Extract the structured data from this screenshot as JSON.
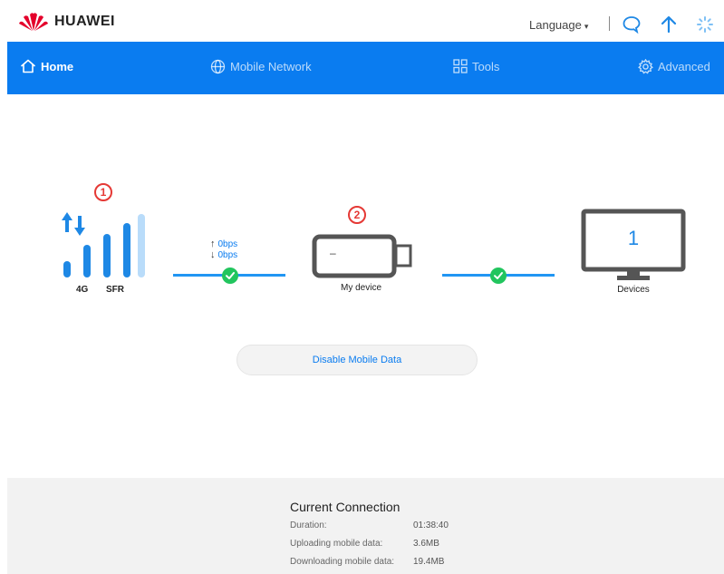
{
  "header": {
    "brand": "HUAWEI",
    "language_label": "Language",
    "brand_color": "#e4002b",
    "icons": [
      "message-icon",
      "upload-arrow-icon",
      "loading-spinner-icon"
    ]
  },
  "nav": {
    "color": "#0a7cf0",
    "items": [
      {
        "label": "Home",
        "icon": "home-icon",
        "active": true
      },
      {
        "label": "Mobile Network",
        "icon": "globe-icon",
        "active": false
      },
      {
        "label": "Tools",
        "icon": "tools-grid-icon",
        "active": false
      },
      {
        "label": "Advanced",
        "icon": "gear-icon",
        "active": false
      }
    ]
  },
  "diagram": {
    "badge1": "1",
    "badge2": "2",
    "network_type": "4G",
    "operator": "SFR",
    "upload_speed": "0bps",
    "download_speed": "0bps",
    "device_label": "My device",
    "device_screen_text": "–",
    "devices_count": "1",
    "devices_label": "Devices",
    "disable_button": "Disable Mobile Data"
  },
  "connection": {
    "title": "Current Connection",
    "rows": [
      {
        "label": "Duration:",
        "value": "01:38:40"
      },
      {
        "label": "Uploading mobile data:",
        "value": "3.6MB"
      },
      {
        "label": "Downloading mobile data:",
        "value": "19.4MB"
      }
    ]
  }
}
